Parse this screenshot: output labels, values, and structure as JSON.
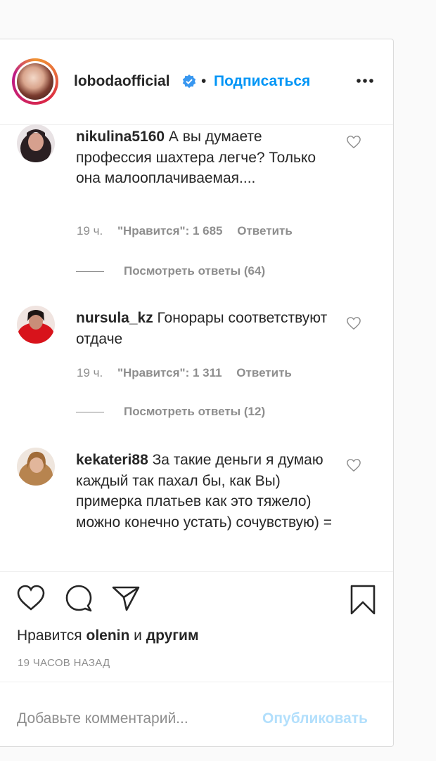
{
  "header": {
    "username": "lobodaofficial",
    "separator": "•",
    "follow_label": "Подписаться"
  },
  "comments": [
    {
      "username": "nikulina5160",
      "text": " А вы думаете профессия шахтера легче? Только она малооплачиваемая....",
      "time": "19 ч.",
      "likes": "\"Нравится\": 1 685",
      "reply_label": "Ответить",
      "view_replies": "Посмотреть ответы (64)"
    },
    {
      "username": "nursula_kz",
      "text": " Гонорары соответствуют отдаче",
      "time": "19 ч.",
      "likes": "\"Нравится\": 1 311",
      "reply_label": "Ответить",
      "view_replies": "Посмотреть ответы (12)"
    },
    {
      "username": "kekateri88",
      "text": " За такие деньги я думаю каждый так пахал бы, как Вы) примерка платьев как это тяжело) можно конечно устать) сочувствую) ="
    }
  ],
  "footer": {
    "likes_prefix": "Нравится ",
    "likes_user": "olenin",
    "likes_and": " и ",
    "likes_others": "другим",
    "time_ago": "19 ЧАСОВ НАЗАД",
    "comment_placeholder": "Добавьте комментарий...",
    "publish_label": "Опубликовать"
  },
  "colors": {
    "accent": "#0095f6",
    "publish_disabled": "#b2dffc",
    "muted": "#8e8e8e"
  }
}
